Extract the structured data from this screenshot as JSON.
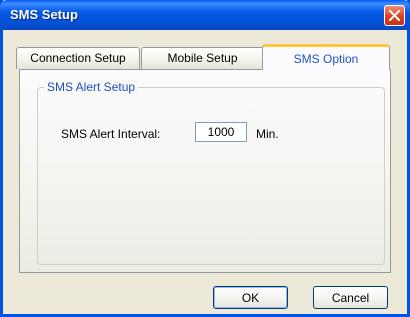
{
  "window": {
    "title": "SMS Setup"
  },
  "tabs": [
    {
      "label": "Connection Setup",
      "active": false
    },
    {
      "label": "Mobile Setup",
      "active": false
    },
    {
      "label": "SMS Option",
      "active": true
    }
  ],
  "sms_alert": {
    "group_title": "SMS Alert Setup",
    "interval_label": "SMS Alert Interval:",
    "interval_value": "1000",
    "unit": "Min."
  },
  "buttons": {
    "ok": "OK",
    "cancel": "Cancel"
  },
  "icons": {
    "close": "close-icon"
  },
  "colors": {
    "title_bar": "#0758e6",
    "close_button": "#d9431d",
    "active_tab_accent": "#ffc83c",
    "accent_text": "#1f4fbf",
    "dialog_background": "#ece9d8"
  }
}
